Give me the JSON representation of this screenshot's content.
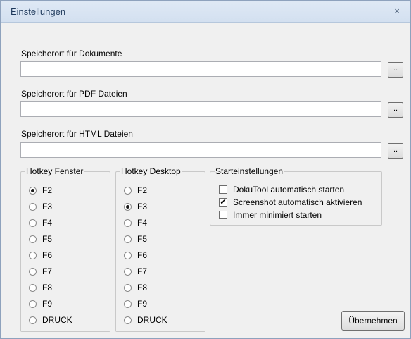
{
  "window": {
    "title": "Einstellungen",
    "close_icon": "×"
  },
  "paths": [
    {
      "label": "Speicherort für Dokumente",
      "value": "",
      "button": ".."
    },
    {
      "label": "Speicherort für PDF Dateien",
      "value": "",
      "button": ".."
    },
    {
      "label": "Speicherort für HTML Dateien",
      "value": "",
      "button": ".."
    }
  ],
  "hotkey_window": {
    "legend": "Hotkey Fenster",
    "options": [
      "F2",
      "F3",
      "F4",
      "F5",
      "F6",
      "F7",
      "F8",
      "F9",
      "DRUCK"
    ],
    "selected": "F2"
  },
  "hotkey_desktop": {
    "legend": "Hotkey Desktop",
    "options": [
      "F2",
      "F3",
      "F4",
      "F5",
      "F6",
      "F7",
      "F8",
      "F9",
      "DRUCK"
    ],
    "selected": "F3"
  },
  "startup": {
    "legend": "Starteinstellungen",
    "options": [
      {
        "label": "DokuTool automatisch starten",
        "checked": false
      },
      {
        "label": "Screenshot automatisch aktivieren",
        "checked": true
      },
      {
        "label": "Immer minimiert starten",
        "checked": false
      }
    ]
  },
  "apply_button": "Übernehmen"
}
